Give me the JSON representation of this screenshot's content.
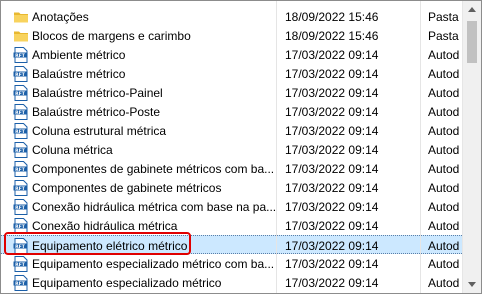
{
  "files": [
    {
      "name": "Anotações",
      "date": "18/09/2022 15:46",
      "type": "Pasta d",
      "icon": "folder-icon",
      "selected": false
    },
    {
      "name": "Blocos de margens e carimbo",
      "date": "18/09/2022 15:46",
      "type": "Pasta d",
      "icon": "folder-icon",
      "selected": false
    },
    {
      "name": "Ambiente métrico",
      "date": "17/03/2022 09:14",
      "type": "Autod",
      "icon": "rft-file-icon",
      "selected": false
    },
    {
      "name": "Balaústre métrico",
      "date": "17/03/2022 09:14",
      "type": "Autod",
      "icon": "rft-file-icon",
      "selected": false
    },
    {
      "name": "Balaústre métrico-Painel",
      "date": "17/03/2022 09:14",
      "type": "Autod",
      "icon": "rft-file-icon",
      "selected": false
    },
    {
      "name": "Balaústre métrico-Poste",
      "date": "17/03/2022 09:14",
      "type": "Autod",
      "icon": "rft-file-icon",
      "selected": false
    },
    {
      "name": "Coluna estrutural métrica",
      "date": "17/03/2022 09:14",
      "type": "Autod",
      "icon": "rft-file-icon",
      "selected": false
    },
    {
      "name": "Coluna métrica",
      "date": "17/03/2022 09:14",
      "type": "Autod",
      "icon": "rft-file-icon",
      "selected": false
    },
    {
      "name": "Componentes de gabinete métricos com ba...",
      "date": "17/03/2022 09:14",
      "type": "Autod",
      "icon": "rft-file-icon",
      "selected": false
    },
    {
      "name": "Componentes de gabinete métricos",
      "date": "17/03/2022 09:14",
      "type": "Autod",
      "icon": "rft-file-icon",
      "selected": false
    },
    {
      "name": "Conexão hidráulica métrica com base na pa...",
      "date": "17/03/2022 09:14",
      "type": "Autod",
      "icon": "rft-file-icon",
      "selected": false
    },
    {
      "name": "Conexão hidráulica métrica",
      "date": "17/03/2022 09:14",
      "type": "Autod",
      "icon": "rft-file-icon",
      "selected": false
    },
    {
      "name": "Equipamento elétrico métrico",
      "date": "17/03/2022 09:14",
      "type": "Autod",
      "icon": "rft-file-icon",
      "selected": true
    },
    {
      "name": "Equipamento especializado métrico com ba...",
      "date": "17/03/2022 09:14",
      "type": "Autod",
      "icon": "rft-file-icon",
      "selected": false
    },
    {
      "name": "Equipamento especializado métrico",
      "date": "17/03/2022 09:14",
      "type": "Autod",
      "icon": "rft-file-icon",
      "selected": false
    }
  ],
  "icon_labels": {
    "rft": "RFT"
  },
  "colors": {
    "selection": "#cce8ff",
    "highlight": "#e00000",
    "folder": "#f5c842",
    "rft_blue": "#1b5fa8"
  }
}
